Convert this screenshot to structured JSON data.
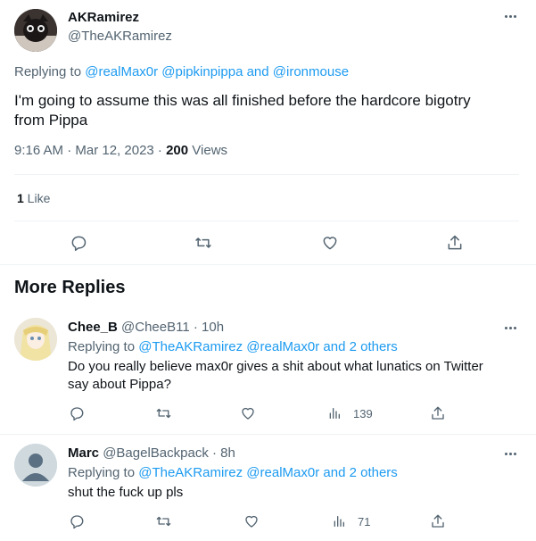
{
  "main_tweet": {
    "display_name": "AKRamirez",
    "handle": "@TheAKRamirez",
    "replying_prefix": "Replying to ",
    "replying_to": "@realMax0r @pipkinpippa and @ironmouse",
    "text_line1": "I'm going to assume this was all finished before the hardcore bigotry",
    "text_line2": "from Pippa",
    "time": "9:16 AM · Mar 12, 2023 · ",
    "views_count": "200",
    "views_label": " Views",
    "likes_count": "1",
    "likes_label": " Like"
  },
  "section_title": "More Replies",
  "replies": [
    {
      "display_name": "Chee_B",
      "handle": "@CheeB11",
      "time": " · 10h",
      "replying_prefix": "Replying to ",
      "replying_to": "@TheAKRamirez @realMax0r and 2 others",
      "text_line1": "Do you really believe max0r gives a shit about what lunatics on Twitter",
      "text_line2": "say about Pippa?",
      "views": "139"
    },
    {
      "display_name": "Marc",
      "handle": "@BagelBackpack",
      "time": " · 8h",
      "replying_prefix": "Replying to ",
      "replying_to": "@TheAKRamirez @realMax0r and 2 others",
      "text_line1": "shut the fuck up pls",
      "views": "71"
    }
  ],
  "icons": {
    "reply": "reply-icon",
    "retweet": "retweet-icon",
    "like": "like-icon",
    "share": "share-icon",
    "views": "views-icon",
    "more": "more-icon"
  },
  "colors": {
    "accent": "#1d9bf0",
    "secondary_text": "#536471",
    "primary_text": "#0f1419",
    "divider": "#eff3f4"
  }
}
